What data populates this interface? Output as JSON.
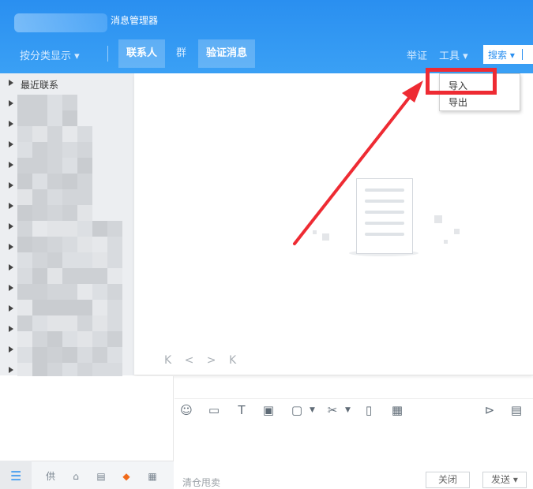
{
  "window": {
    "title": "消息管理器"
  },
  "header": {
    "category_label": "按分类显示 ▾",
    "tabs": [
      {
        "label": "联系人",
        "active": true
      },
      {
        "label": "群",
        "active": false
      },
      {
        "label": "验证消息",
        "active": true
      }
    ],
    "report_label": "举证",
    "tools_label": "工具 ▾",
    "search_label": "搜索 ▾"
  },
  "tools_menu": {
    "items": [
      {
        "label": "导入"
      },
      {
        "label": "导出"
      }
    ]
  },
  "contact_tree": {
    "first_group": "最近联系"
  },
  "pager": {
    "glyphs": "K < > K"
  },
  "chat": {
    "quick_reply": "清仓甩卖",
    "close_label": "关闭",
    "send_label": "发送 ▾"
  },
  "colors": {
    "header_blue": "#2a8ff0",
    "highlight_red": "#ee2b33"
  }
}
